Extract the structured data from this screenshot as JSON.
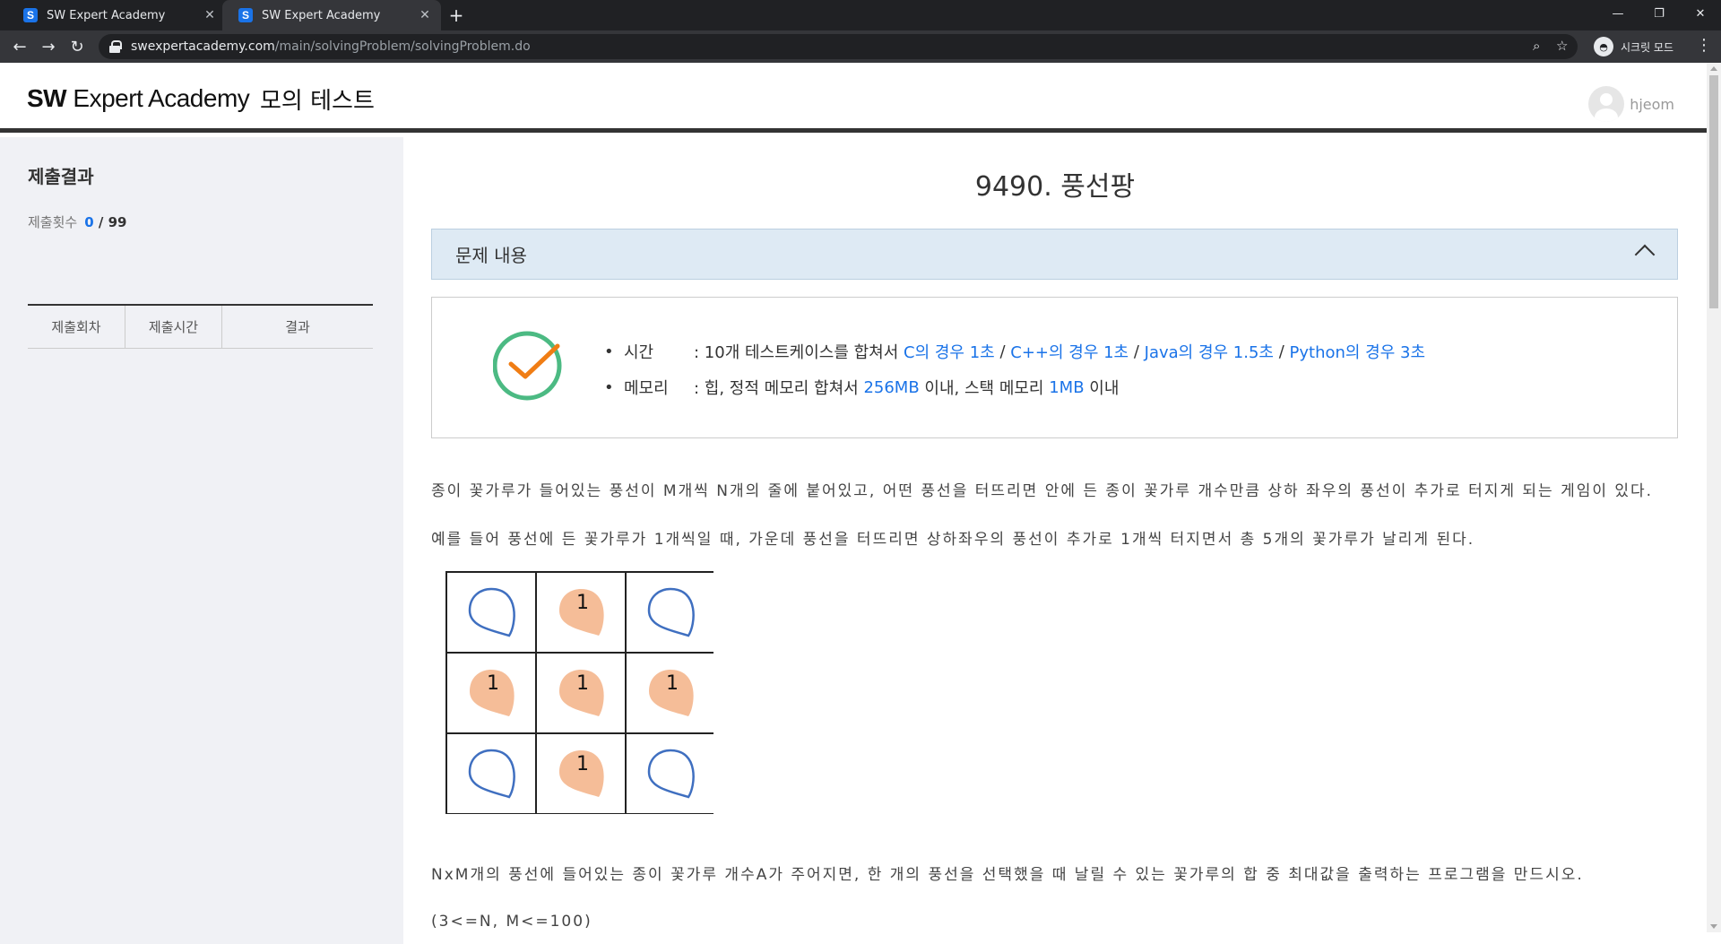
{
  "browser": {
    "tabs": [
      {
        "title": "SW Expert Academy",
        "favicon": "S",
        "active": false
      },
      {
        "title": "SW Expert Academy",
        "favicon": "S",
        "active": true
      }
    ],
    "url_host": "swexpertacademy.com",
    "url_path": "/main/solvingProblem/solvingProblem.do",
    "incognito_label": "시크릿 모드"
  },
  "header": {
    "logo_sw": "SW",
    "logo_rest": " Expert Academy",
    "test_title": "모의 테스트",
    "username": "hjeom"
  },
  "sidebar": {
    "title": "제출결과",
    "count_label": "제출횟수",
    "count_value": "0",
    "count_sep": "/",
    "count_total": "99",
    "columns": [
      "제출회차",
      "제출시간",
      "결과"
    ]
  },
  "problem": {
    "title": "9490. 풍선팡",
    "section_label": "문제 내용",
    "limits": {
      "time_label": "시간",
      "time_prefix": ": 10개 테스트케이스를 합쳐서 ",
      "time_c": "C의 경우 1초",
      "sep": " / ",
      "time_cpp": "C++의 경우 1초",
      "time_java": "Java의 경우 1.5초",
      "time_python": "Python의 경우 3초",
      "memory_label": "메모리",
      "memory_prefix": ": 힙, 정적 메모리 합쳐서 ",
      "memory_heap": "256MB",
      "memory_mid": " 이내, 스택 메모리 ",
      "memory_stack": "1MB",
      "memory_suffix": " 이내"
    },
    "desc1": "종이 꽃가루가 들어있는 풍선이 M개씩 N개의 줄에 붙어있고, 어떤 풍선을 터뜨리면 안에 든 종이 꽃가루 개수만큼 상하 좌우의 풍선이 추가로 터지게 되는 게임이 있다.",
    "desc2": "예를 들어 풍선에 든 꽃가루가 1개씩일 때, 가운데 풍선을 터뜨리면 상하좌우의 풍선이 추가로 1개씩 터지면서 총 5개의 꽃가루가 날리게 된다.",
    "desc3": "NxM개의 풍선에 들어있는 종이 꽃가루 개수A가 주어지면, 한 개의 풍선을 선택했을 때 날릴 수 있는 꽃가루의 합 중 최대값을 출력하는 프로그램을 만드시오.",
    "desc4": "(3<=N, M<=100)",
    "grid": [
      [
        "empty",
        "popped",
        "empty"
      ],
      [
        "popped",
        "popped",
        "popped"
      ],
      [
        "empty",
        "popped",
        "empty"
      ]
    ],
    "popped_label": "1",
    "colors": {
      "balloon_outline": "#3f6fc0",
      "popped_fill": "#f5bd98",
      "check_circle": "#4cba83",
      "check_mark": "#f07d14",
      "link": "#1a73e8"
    }
  }
}
